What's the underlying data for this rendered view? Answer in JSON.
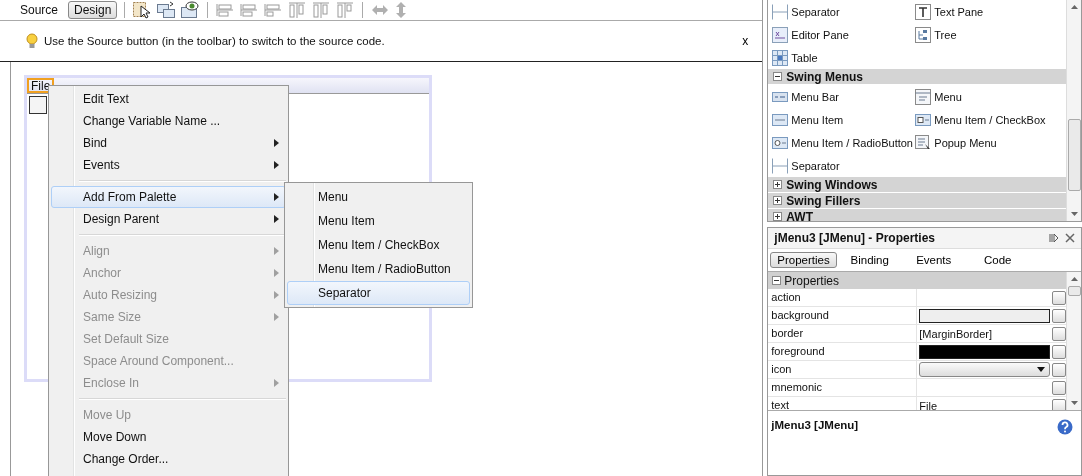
{
  "toolbar": {
    "tabs": [
      {
        "label": "Source",
        "selected": false
      },
      {
        "label": "Design",
        "selected": true
      }
    ]
  },
  "hint": {
    "text": "Use the Source button (in the toolbar) to switch to the source code.",
    "close": "x"
  },
  "form": {
    "menus": [
      {
        "label": "File",
        "selected": true
      }
    ]
  },
  "context_menu": {
    "groups": [
      [
        {
          "label": "Edit Text",
          "disabled": false,
          "submenu": false,
          "selected": false
        },
        {
          "label": "Change Variable Name ...",
          "disabled": false,
          "submenu": false,
          "selected": false
        },
        {
          "label": "Bind",
          "disabled": false,
          "submenu": true,
          "selected": false
        },
        {
          "label": "Events",
          "disabled": false,
          "submenu": true,
          "selected": false
        }
      ],
      [
        {
          "label": "Add From Palette",
          "disabled": false,
          "submenu": true,
          "selected": true
        },
        {
          "label": "Design Parent",
          "disabled": false,
          "submenu": true,
          "selected": false
        }
      ],
      [
        {
          "label": "Align",
          "disabled": true,
          "submenu": true,
          "selected": false
        },
        {
          "label": "Anchor",
          "disabled": true,
          "submenu": true,
          "selected": false
        },
        {
          "label": "Auto Resizing",
          "disabled": true,
          "submenu": true,
          "selected": false
        },
        {
          "label": "Same Size",
          "disabled": true,
          "submenu": true,
          "selected": false
        },
        {
          "label": "Set Default Size",
          "disabled": true,
          "submenu": false,
          "selected": false
        },
        {
          "label": "Space Around Component...",
          "disabled": true,
          "submenu": false,
          "selected": false
        },
        {
          "label": "Enclose In",
          "disabled": true,
          "submenu": true,
          "selected": false
        }
      ],
      [
        {
          "label": "Move Up",
          "disabled": true,
          "submenu": false,
          "selected": false
        },
        {
          "label": "Move Down",
          "disabled": false,
          "submenu": false,
          "selected": false
        },
        {
          "label": "Change Order...",
          "disabled": false,
          "submenu": false,
          "selected": false
        }
      ]
    ]
  },
  "submenu": {
    "items": [
      {
        "label": "Menu",
        "selected": false
      },
      {
        "label": "Menu Item",
        "selected": false
      },
      {
        "label": "Menu Item / CheckBox",
        "selected": false
      },
      {
        "label": "Menu Item / RadioButton",
        "selected": false
      },
      {
        "label": "Separator",
        "selected": true
      }
    ]
  },
  "palette": {
    "items": [
      {
        "label": "Separator",
        "kind": "separator"
      },
      {
        "label": "Text Pane",
        "kind": "text-pane"
      },
      {
        "label": "Editor Pane",
        "kind": "editor-pane"
      },
      {
        "label": "Tree",
        "kind": "tree"
      },
      {
        "label": "Table",
        "kind": "table"
      }
    ],
    "categories": [
      {
        "label": "Swing Menus",
        "expanded": true,
        "items": [
          {
            "label": "Menu Bar",
            "kind": "menu-bar"
          },
          {
            "label": "Menu",
            "kind": "menu"
          },
          {
            "label": "Menu Item",
            "kind": "menu-item"
          },
          {
            "label": "Menu Item / CheckBox",
            "kind": "checkbox-item"
          },
          {
            "label": "Menu Item / RadioButton",
            "kind": "radio-item"
          },
          {
            "label": "Popup Menu",
            "kind": "popup-menu"
          },
          {
            "label": "Separator",
            "kind": "separator"
          }
        ]
      },
      {
        "label": "Swing Windows",
        "expanded": false
      },
      {
        "label": "Swing Fillers",
        "expanded": false
      },
      {
        "label": "AWT",
        "expanded": false
      }
    ]
  },
  "properties": {
    "title": "jMenu3 [JMenu] - Properties",
    "tabs": [
      {
        "label": "Properties",
        "selected": true
      },
      {
        "label": "Binding",
        "selected": false
      },
      {
        "label": "Events",
        "selected": false
      },
      {
        "label": "Code",
        "selected": false
      }
    ],
    "section": {
      "label": "Properties",
      "expanded": true
    },
    "rows": [
      {
        "name": "action",
        "kind": "empty"
      },
      {
        "name": "background",
        "kind": "swatch",
        "color": "#eeeeee"
      },
      {
        "name": "border",
        "kind": "text",
        "value": "[MarginBorder]"
      },
      {
        "name": "foreground",
        "kind": "swatch",
        "color": "#000000"
      },
      {
        "name": "icon",
        "kind": "combo"
      },
      {
        "name": "mnemonic",
        "kind": "empty"
      },
      {
        "name": "text",
        "kind": "text",
        "value": "File"
      }
    ],
    "description": "jMenu3 [JMenu]"
  }
}
